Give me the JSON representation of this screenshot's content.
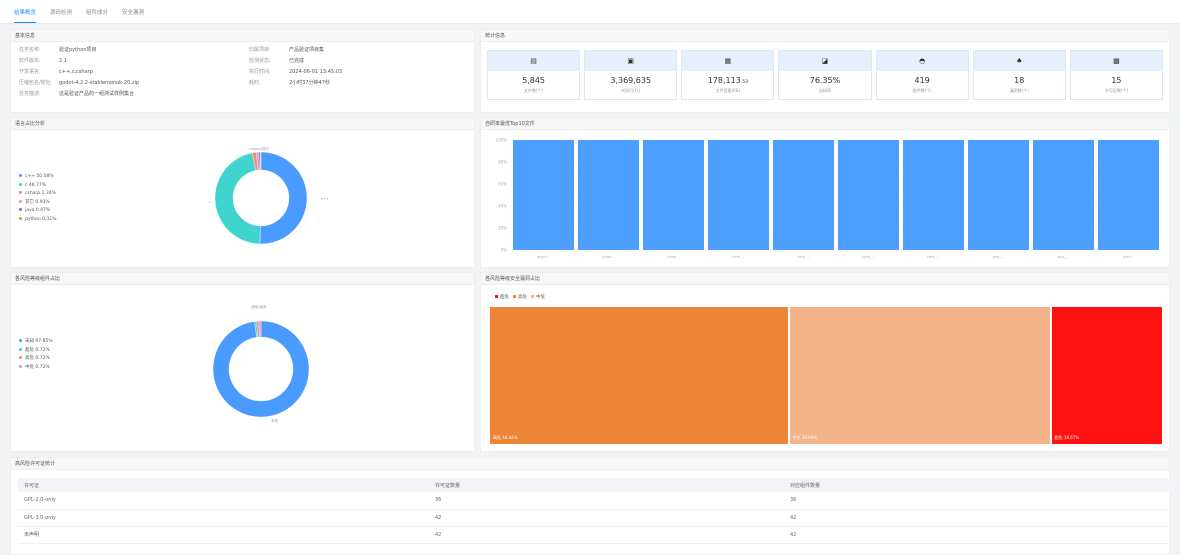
{
  "tabs": [
    "结果概览",
    "源码检测",
    "组件成分",
    "安全漏洞"
  ],
  "basic": {
    "title": "基本信息",
    "left": [
      {
        "k": "任务名称:",
        "v": "验证python项目"
      },
      {
        "k": "软件版本:",
        "v": "2.1"
      },
      {
        "k": "开发语言:",
        "v": "c++,c,csharp"
      },
      {
        "k": "压缩包名/地址:",
        "v": "godot-4.2.2-stablemonok-20.zip"
      },
      {
        "k": "任务描述:",
        "v": "这是验证产品的一组测试样例集合"
      }
    ],
    "right": [
      {
        "k": "归属项目:",
        "v": "产品验证项目集"
      },
      {
        "k": "检测状态:",
        "v": "已完成"
      },
      {
        "k": "执行时间:",
        "v": "2024-06-01 13:45:03"
      },
      {
        "k": "耗时:",
        "v": "2小时37分钟47秒"
      }
    ]
  },
  "stats": {
    "title": "统计信息",
    "cards": [
      {
        "icon": "file-icon",
        "glyph": "▤",
        "value": "5,845",
        "unit": "",
        "label": "文件数(个)"
      },
      {
        "icon": "code-icon",
        "glyph": "▣",
        "value": "3,369,635",
        "unit": "",
        "label": "代码行(行)"
      },
      {
        "icon": "storage-icon",
        "glyph": "▦",
        "value": "178,113",
        "unit": ".53",
        "label": "文件容量(KB)"
      },
      {
        "icon": "percent-icon",
        "glyph": "◪",
        "value": "76.35%",
        "unit": "",
        "label": "自研率"
      },
      {
        "icon": "component-icon",
        "glyph": "◓",
        "value": "419",
        "unit": "",
        "label": "组件数(个)"
      },
      {
        "icon": "bug-icon",
        "glyph": "♠",
        "value": "18",
        "unit": "",
        "label": "漏洞数(个)"
      },
      {
        "icon": "license-icon",
        "glyph": "▩",
        "value": "15",
        "unit": "",
        "label": "许可证数(个)"
      }
    ]
  },
  "chart_data": [
    {
      "type": "pie",
      "title": "语言占比分析",
      "labels": [
        "c++",
        "c",
        "csharp",
        "其它",
        "java",
        "python"
      ],
      "values": [
        50.58,
        46.77,
        1.34,
        0.93,
        0.47,
        0.31
      ],
      "colors": [
        "#4a9bff",
        "#3fd4d0",
        "#f58a7a",
        "#e98fd0",
        "#7b68d8",
        "#73c85a"
      ],
      "outer_labels": [
        "c++",
        "c",
        "csharp/其它"
      ]
    },
    {
      "type": "bar",
      "title": "自研率最低Top10文件",
      "categories": [
        "engin...",
        "proje...",
        "proje...",
        "core_...",
        "core_...",
        "core_...",
        "core_...",
        "test_...",
        "test_...",
        "scen..."
      ],
      "values": [
        100,
        100,
        100,
        100,
        100,
        100,
        100,
        100,
        100,
        100
      ],
      "yticks": [
        "0%",
        "20%",
        "40%",
        "60%",
        "80%",
        "100%"
      ],
      "ylim": [
        0,
        100
      ]
    },
    {
      "type": "pie",
      "title": "各风险等级组件占比",
      "labels": [
        "未知",
        "超危",
        "高危",
        "中危"
      ],
      "values": [
        97.85,
        0.72,
        0.72,
        0.72
      ],
      "colors": [
        "#4a9bff",
        "#3fd4d0",
        "#f58a7a",
        "#e98fd0"
      ],
      "outer_labels": [
        "未知",
        "超危/高危"
      ]
    },
    {
      "type": "treemap",
      "title": "各风险等级安全漏洞占比",
      "legend": [
        "超危",
        "高危",
        "中危"
      ],
      "labels": [
        "高危",
        "中危",
        "超危"
      ],
      "values": [
        44.44,
        38.89,
        16.67
      ],
      "colors": [
        "#ed8436",
        "#f4b487",
        "#ff1212"
      ]
    }
  ],
  "licenses": {
    "title": "高风险许可证统计",
    "headers": [
      "许可证",
      "许可证数量",
      "对应组件数量"
    ],
    "rows": [
      [
        "GPL-2.0-only",
        "36",
        "36"
      ],
      [
        "GPL-3.0-only",
        "42",
        "42"
      ],
      [
        "未声明",
        "42",
        "42"
      ]
    ]
  }
}
